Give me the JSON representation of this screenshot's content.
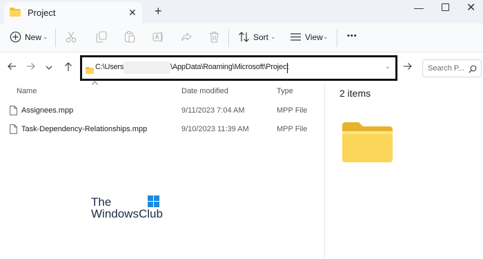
{
  "window": {
    "tab_title": "Project",
    "new_tab_symbol": "+"
  },
  "toolbar": {
    "new_label": "New",
    "sort_label": "Sort",
    "view_label": "View",
    "more_symbol": "•••",
    "icons": [
      "new-icon",
      "cut-icon",
      "copy-icon",
      "paste-icon",
      "rename-icon",
      "share-icon",
      "delete-icon",
      "sort-icon",
      "view-icon"
    ]
  },
  "address": {
    "prefix": "C:\\Users\\",
    "suffix": "\\AppData\\Roaming\\Microsoft\\Project",
    "search_placeholder": "Search P..."
  },
  "file_list": {
    "columns": {
      "name": "Name",
      "date": "Date modified",
      "type": "Type"
    },
    "rows": [
      {
        "name": "Assignees.mpp",
        "date": "9/11/2023 7:04 AM",
        "type": "MPP File"
      },
      {
        "name": "Task-Dependency-Relationships.mpp",
        "date": "9/10/2023 11:39 AM",
        "type": "MPP File"
      }
    ]
  },
  "preview": {
    "items_count": "2 items"
  },
  "watermark": {
    "line1": "The",
    "line2": "WindowsClub"
  },
  "colors": {
    "folder_yellow": "#f4c63d",
    "folder_light": "#fbe38a",
    "address_border": "#111111",
    "logo_blue": "#1b8be0"
  }
}
